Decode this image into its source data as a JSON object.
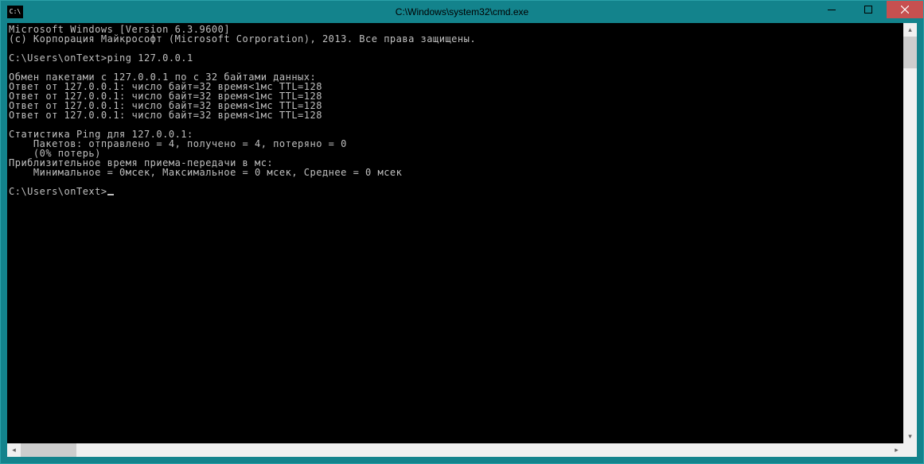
{
  "window": {
    "title": "C:\\Windows\\system32\\cmd.exe",
    "icon_glyph": "C:\\"
  },
  "terminal": {
    "lines": [
      "Microsoft Windows [Version 6.3.9600]",
      "(c) Корпорация Майкрософт (Microsoft Corporation), 2013. Все права защищены.",
      "",
      "C:\\Users\\onText>ping 127.0.0.1",
      "",
      "Обмен пакетами с 127.0.0.1 по с 32 байтами данных:",
      "Ответ от 127.0.0.1: число байт=32 время<1мс TTL=128",
      "Ответ от 127.0.0.1: число байт=32 время<1мс TTL=128",
      "Ответ от 127.0.0.1: число байт=32 время<1мс TTL=128",
      "Ответ от 127.0.0.1: число байт=32 время<1мс TTL=128",
      "",
      "Статистика Ping для 127.0.0.1:",
      "    Пакетов: отправлено = 4, получено = 4, потеряно = 0",
      "    (0% потерь)",
      "Приблизительное время приема-передачи в мс:",
      "    Минимальное = 0мсек, Максимальное = 0 мсек, Среднее = 0 мсек",
      "",
      "C:\\Users\\onText>"
    ],
    "cursor_line_index": 17
  }
}
